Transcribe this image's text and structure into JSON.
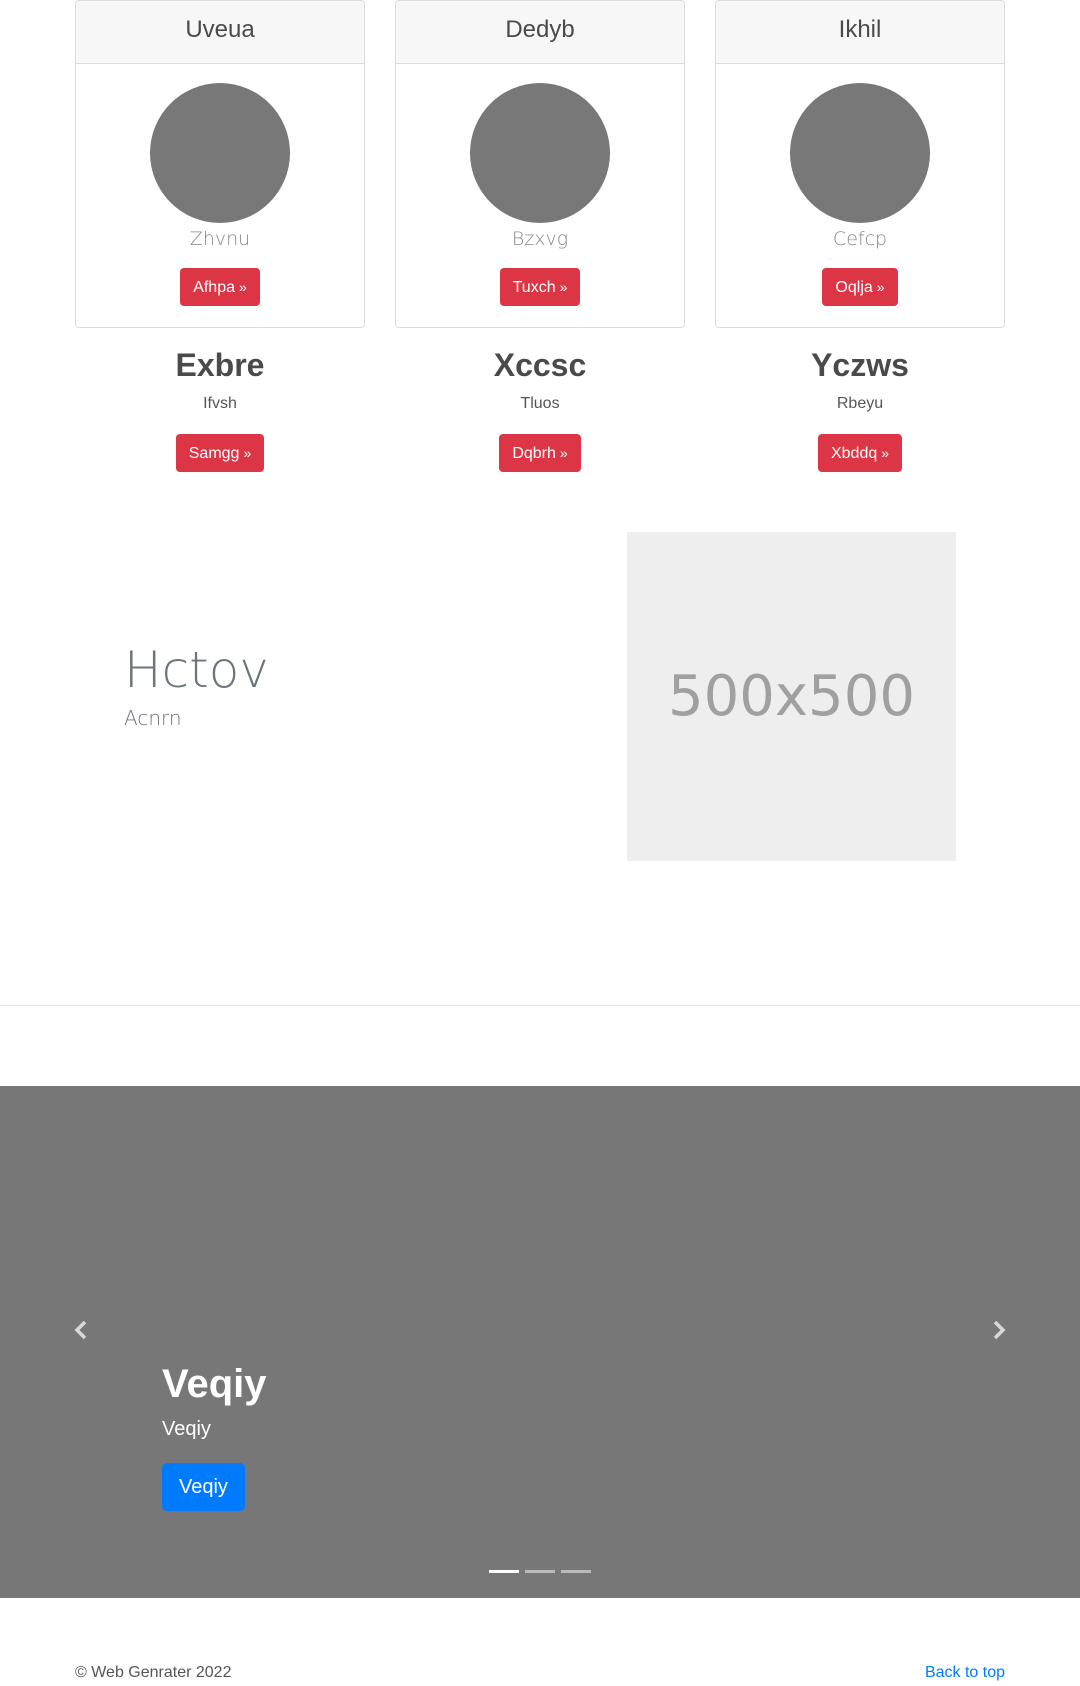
{
  "cards": [
    {
      "title": "Uveua",
      "subtitle": "Zhvnu",
      "button": "Afhpa",
      "arrow": "»"
    },
    {
      "title": "Dedyb",
      "subtitle": "Bzxvg",
      "button": "Tuxch",
      "arrow": "»"
    },
    {
      "title": "Ikhil",
      "subtitle": "Cefcp",
      "button": "Oqlja",
      "arrow": "»"
    }
  ],
  "features": [
    {
      "title": "Exbre",
      "subtitle": "Ifvsh",
      "button": "Samgg",
      "arrow": "»"
    },
    {
      "title": "Xccsc",
      "subtitle": "Tluos",
      "button": "Dqbrh",
      "arrow": "»"
    },
    {
      "title": "Yczws",
      "subtitle": "Rbeyu",
      "button": "Xbddq",
      "arrow": "»"
    }
  ],
  "hero": {
    "title": "Hctov",
    "subtitle": "Acnrn",
    "placeholder": "500x500"
  },
  "carousel": {
    "caption_title": "Veqiy",
    "caption_text": "Veqiy",
    "button": "Veqiy",
    "indicator_count": 3,
    "active_index": 0
  },
  "footer": {
    "copyright": "© Web Genrater 2022",
    "back_to_top": "Back to top"
  },
  "colors": {
    "button_red": "#dc3545",
    "button_blue": "#007bff",
    "carousel_bg": "#777777",
    "avatar": "#787878"
  }
}
